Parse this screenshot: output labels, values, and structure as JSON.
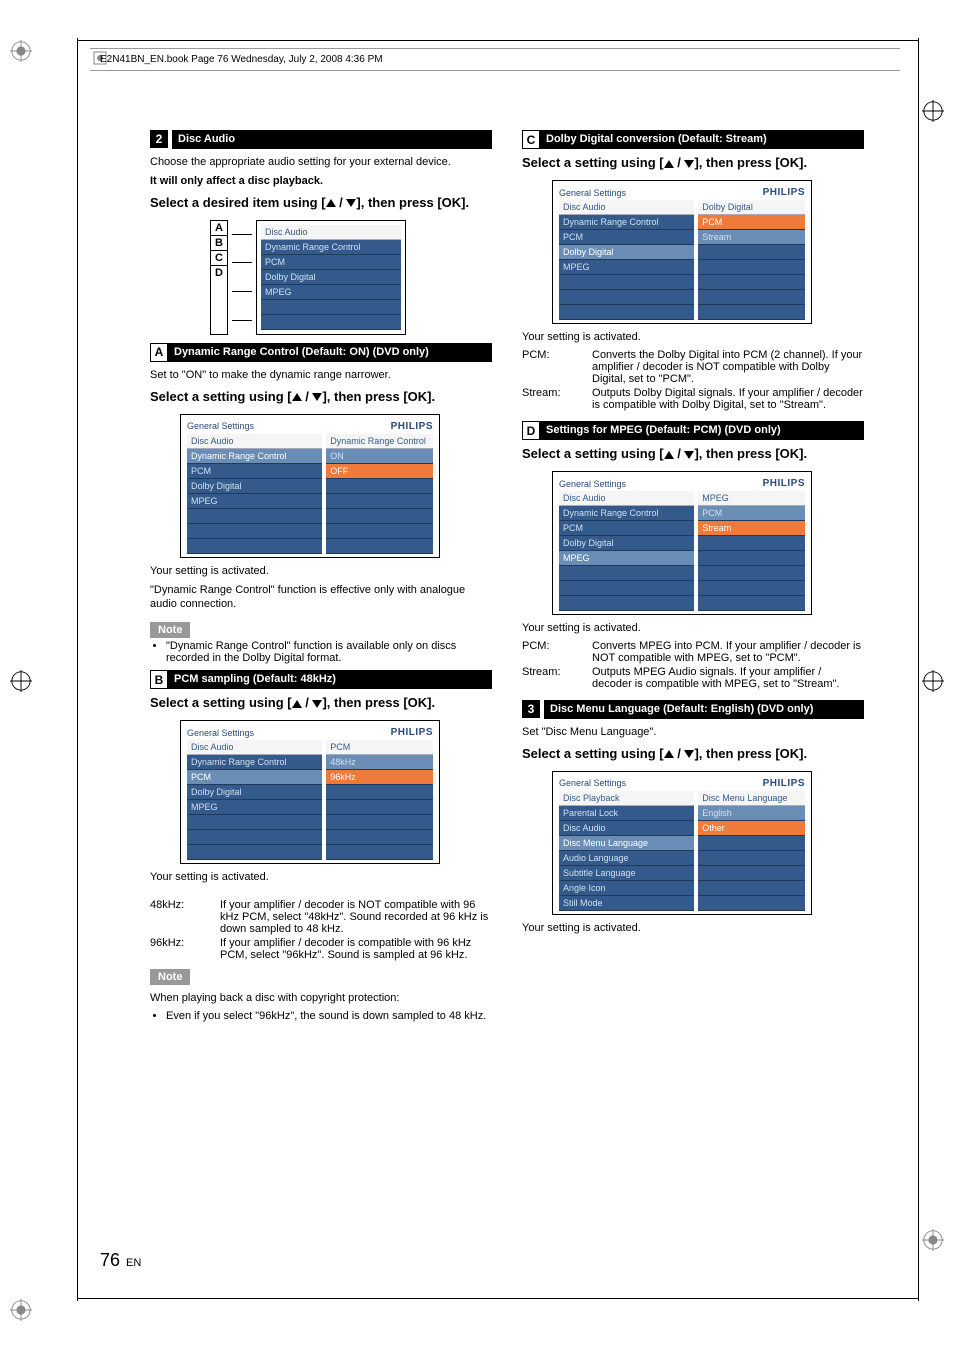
{
  "meta": {
    "header": "E2N41BN_EN.book  Page 76  Wednesday, July 2, 2008  4:36 PM"
  },
  "page": {
    "num": "76",
    "lang": "EN"
  },
  "s2": {
    "num": "2",
    "title": "Disc Audio",
    "p1": "Choose the appropriate audio setting for your external device.",
    "p2": "It will only affect a disc playback.",
    "instr": "Select a desired item using [▲ / ▼], then press [OK].",
    "abcd": {
      "header": "Disc Audio",
      "items": [
        "Dynamic Range Control",
        "PCM",
        "Dolby Digital",
        "MPEG"
      ]
    }
  },
  "A": {
    "letter": "A",
    "title": "Dynamic Range Control (Default: ON) (DVD only)",
    "p1": "Set to \"ON\" to make the dynamic range narrower.",
    "instr": "Select a setting using [▲ / ▼], then press [OK].",
    "menu": {
      "title": "General Settings",
      "brand": "PHILIPS",
      "leftHeader": "Disc Audio",
      "rightHeader": "Dynamic Range Control",
      "left": [
        "Dynamic Range Control",
        "PCM",
        "Dolby Digital",
        "MPEG"
      ],
      "right": [
        "ON",
        "OFF"
      ]
    },
    "p2": "Your setting is activated.",
    "p3": "\"Dynamic Range Control\" function is effective only with analogue audio connection.",
    "note": "Note",
    "noteItem": "\"Dynamic Range Control\" function is available only on discs recorded in the Dolby Digital format."
  },
  "B": {
    "letter": "B",
    "title": "PCM sampling (Default: 48kHz)",
    "instr": "Select a setting using [▲ / ▼], then press [OK].",
    "menu": {
      "title": "General Settings",
      "brand": "PHILIPS",
      "leftHeader": "Disc Audio",
      "rightHeader": "PCM",
      "left": [
        "Dynamic Range Control",
        "PCM",
        "Dolby Digital",
        "MPEG"
      ],
      "right": [
        "48kHz",
        "96kHz"
      ]
    },
    "p1": "Your setting is activated.",
    "def1": {
      "term": "48kHz:",
      "def": "If your amplifier / decoder is NOT compatible with 96 kHz PCM, select \"48kHz\". Sound recorded at 96 kHz is down sampled to 48 kHz."
    },
    "def2": {
      "term": "96kHz:",
      "def": "If your amplifier / decoder is compatible with 96 kHz PCM, select \"96kHz\". Sound is sampled at 96 kHz."
    },
    "note": "Note",
    "noteP": "When playing back a disc with copyright protection:",
    "noteItem": "Even if you select \"96kHz\", the sound is down sampled to 48 kHz."
  },
  "C": {
    "letter": "C",
    "title": "Dolby Digital conversion (Default: Stream)",
    "instr": "Select a setting using [▲ / ▼], then press [OK].",
    "menu": {
      "title": "General Settings",
      "brand": "PHILIPS",
      "leftHeader": "Disc Audio",
      "rightHeader": "Dolby Digital",
      "left": [
        "Dynamic Range Control",
        "PCM",
        "Dolby Digital",
        "MPEG"
      ],
      "right": [
        "PCM",
        "Stream"
      ]
    },
    "p1": "Your setting is activated.",
    "def1": {
      "term": "PCM:",
      "def": "Converts the Dolby Digital into PCM (2 channel). If your amplifier / decoder is NOT compatible with Dolby Digital, set to \"PCM\"."
    },
    "def2": {
      "term": "Stream:",
      "def": "Outputs Dolby Digital signals. If your amplifier / decoder is compatible with Dolby Digital, set to \"Stream\"."
    }
  },
  "D": {
    "letter": "D",
    "title": "Settings for MPEG (Default: PCM) (DVD only)",
    "instr": "Select a setting using [▲ / ▼], then press [OK].",
    "menu": {
      "title": "General Settings",
      "brand": "PHILIPS",
      "leftHeader": "Disc Audio",
      "rightHeader": "MPEG",
      "left": [
        "Dynamic Range Control",
        "PCM",
        "Dolby Digital",
        "MPEG"
      ],
      "right": [
        "PCM",
        "Stream"
      ]
    },
    "p1": "Your setting is activated.",
    "def1": {
      "term": "PCM:",
      "def": "Converts MPEG into PCM. If your amplifier / decoder is NOT compatible with MPEG, set to \"PCM\"."
    },
    "def2": {
      "term": "Stream:",
      "def": "Outputs MPEG Audio signals. If your amplifier / decoder is compatible with MPEG, set to \"Stream\"."
    }
  },
  "s3": {
    "num": "3",
    "title": "Disc Menu Language (Default: English) (DVD only)",
    "p1": "Set \"Disc Menu Language\".",
    "instr": "Select a setting using [▲ / ▼], then press [OK].",
    "menu": {
      "title": "General Settings",
      "brand": "PHILIPS",
      "leftHeader": "Disc Playback",
      "rightHeader": "Disc Menu Language",
      "left": [
        "Parental Lock",
        "Disc Audio",
        "Disc Menu Language",
        "Audio Language",
        "Subtitle Language",
        "Angle Icon",
        "Still Mode"
      ],
      "right": [
        "English",
        "Other"
      ]
    },
    "p2": "Your setting is activated."
  }
}
